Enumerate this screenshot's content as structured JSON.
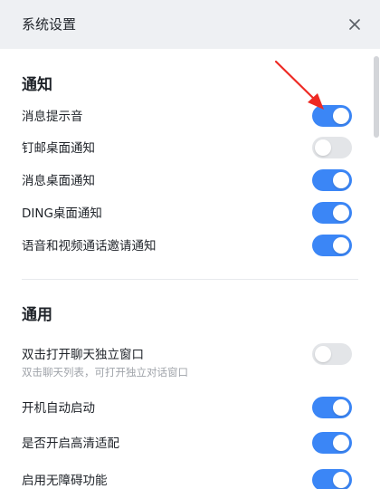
{
  "window": {
    "title": "系统设置",
    "close_icon": "close-icon"
  },
  "sections": {
    "notify": {
      "title": "通知",
      "items": [
        {
          "label": "消息提示音",
          "on": true
        },
        {
          "label": "钉邮桌面通知",
          "on": false
        },
        {
          "label": "消息桌面通知",
          "on": true
        },
        {
          "label": "DING桌面通知",
          "on": true
        },
        {
          "label": "语音和视频通话邀请通知",
          "on": true
        }
      ]
    },
    "general": {
      "title": "通用",
      "items": [
        {
          "label": "双击打开聊天独立窗口",
          "sub": "双击聊天列表，可打开独立对话窗口",
          "on": false
        },
        {
          "label": "开机自动启动",
          "on": true
        },
        {
          "label": "是否开启高清适配",
          "on": true
        },
        {
          "label": "启用无障碍功能",
          "on": true
        }
      ]
    }
  },
  "colors": {
    "accent": "#3b86f6",
    "toggle_off": "#e3e5e8",
    "annotation_arrow": "#ee2a24",
    "titlebar_bg": "#eef0f3"
  }
}
